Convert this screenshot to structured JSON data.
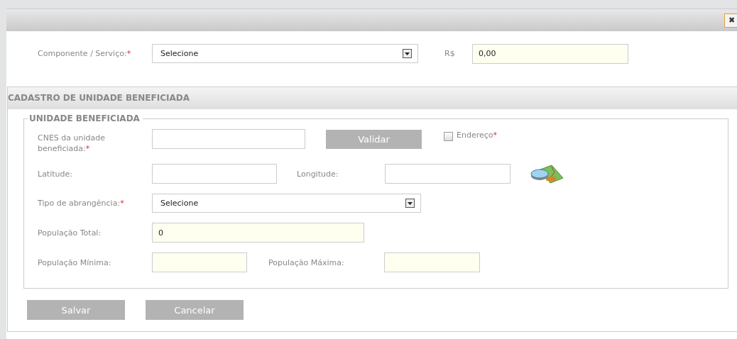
{
  "dialog": {
    "close_symbol": "✖"
  },
  "top_fields": [
    {
      "label": "Componente / Serviço:",
      "required_mark": "*",
      "kind": "select",
      "value": "Selecione"
    },
    {
      "label": "R$",
      "kind": "input",
      "value": "0,00",
      "highlighted": true
    }
  ],
  "section": {
    "title": "CADASTRO DE UNIDADE BENEFICIADA",
    "fieldset": {
      "legend": "UNIDADE BENEFICIADA",
      "cnes": {
        "label": "CNES da unidade beneficiada:",
        "required_mark": "*",
        "button": "Validar",
        "checkbox": {
          "label": "Endereço",
          "required_mark": "*",
          "checked": false
        }
      },
      "latitude": {
        "label": "Latitude:"
      },
      "longitude": {
        "label": "Longitude:"
      },
      "tipo": {
        "label": "Tipo de abrangência:",
        "required_mark": "*",
        "value": "Selecione"
      },
      "populacao_total": {
        "label": "População Total:",
        "value": "0",
        "highlighted": true
      },
      "populacao_minima": {
        "label": "População Mínima:",
        "highlighted": true
      },
      "populacao_maxima": {
        "label": "População Máxima:",
        "highlighted": true
      }
    }
  },
  "buttons": [
    "Salvar",
    "Cancelar"
  ]
}
